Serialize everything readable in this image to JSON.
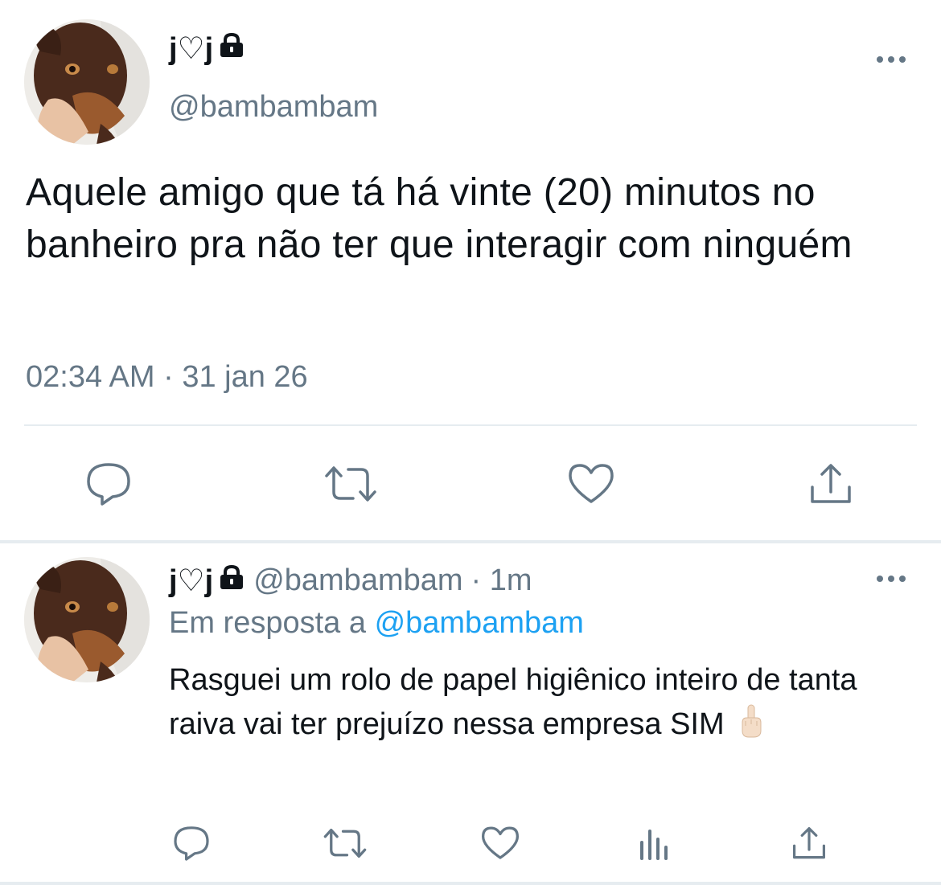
{
  "main_tweet": {
    "author_name": "j♡j",
    "handle": "@bambambam",
    "text": "Aquele amigo que tá há vinte (20) minutos no banheiro pra não ter que interagir com ninguém",
    "timestamp": "02:34 AM · 31 jan 26",
    "icons": [
      "lock-icon",
      "more-icon",
      "reply-icon",
      "retweet-icon",
      "like-icon",
      "share-icon"
    ]
  },
  "reply_tweet": {
    "author_name": "j♡j",
    "handle": "@bambambam",
    "age": "· 1m",
    "reply_to_label": "Em resposta a",
    "reply_to_mention": "@bambambam",
    "text_before_emoji": "Rasguei um rolo de papel higiênico inteiro de tanta raiva vai ter prejuízo nessa empresa SIM",
    "icons": [
      "lock-icon",
      "more-icon",
      "reply-icon",
      "retweet-icon",
      "like-icon",
      "analytics-icon",
      "share-icon"
    ]
  },
  "colors": {
    "text": "#0f1419",
    "secondary": "#657786",
    "accent": "#1da1f2",
    "divider": "#e6ecf0"
  }
}
